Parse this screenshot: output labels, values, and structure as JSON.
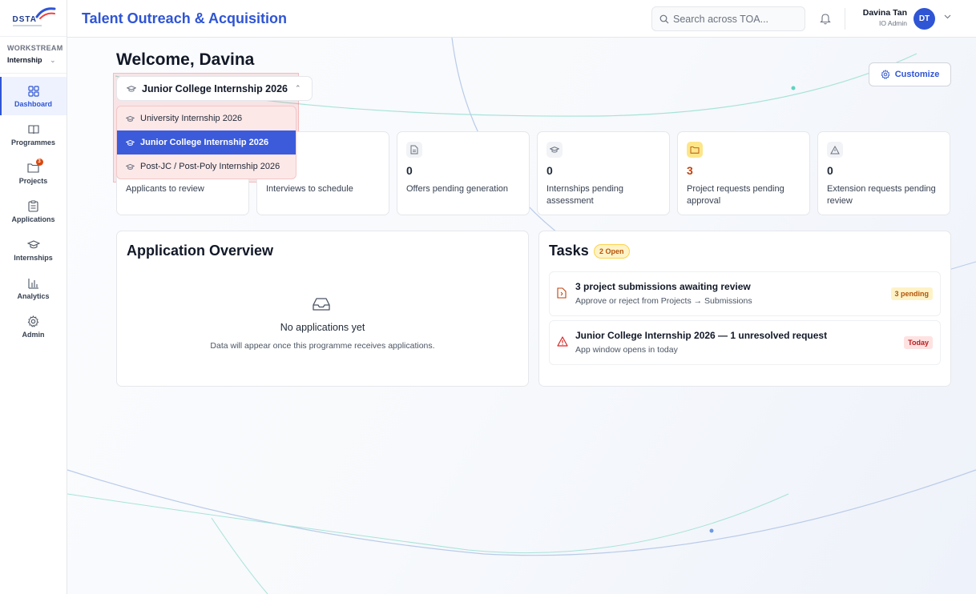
{
  "brand": {
    "logo_text": "DSTA"
  },
  "header": {
    "title": "Talent Outreach & Acquisition",
    "search_placeholder": "Search across TOA...",
    "user_name": "Davina Tan",
    "user_role": "IO Admin",
    "user_initials": "DT"
  },
  "sidebar": {
    "workstream_label": "WORKSTREAM",
    "workstream_value": "Internship",
    "items": [
      {
        "label": "Dashboard",
        "icon": "grid-icon",
        "active": true
      },
      {
        "label": "Programmes",
        "icon": "book-icon"
      },
      {
        "label": "Projects",
        "icon": "folder-icon",
        "badge": "3"
      },
      {
        "label": "Applications",
        "icon": "clipboard-icon"
      },
      {
        "label": "Internships",
        "icon": "graduation-cap-icon"
      },
      {
        "label": "Analytics",
        "icon": "bar-chart-icon"
      },
      {
        "label": "Admin",
        "icon": "gear-icon"
      }
    ]
  },
  "main": {
    "welcome": "Welcome, Davina",
    "customize_label": "Customize",
    "programme_selector": {
      "selected": "Junior College Internship 2026",
      "options": [
        "University Internship 2026",
        "Junior College Internship 2026",
        "Post-JC / Post-Poly Internship 2026"
      ]
    },
    "stats": [
      {
        "value": "",
        "label": "Applicants to review",
        "icon": "clipboard-icon"
      },
      {
        "value": "",
        "label": "Interviews to schedule",
        "icon": "calendar-icon"
      },
      {
        "value": "0",
        "label": "Offers pending generation",
        "icon": "document-icon"
      },
      {
        "value": "0",
        "label": "Internships pending assessment",
        "icon": "graduation-cap-icon"
      },
      {
        "value": "3",
        "label": "Project requests pending approval",
        "icon": "folder-icon"
      },
      {
        "value": "0",
        "label": "Extension requests pending review",
        "icon": "warning-icon"
      }
    ],
    "overview": {
      "title": "Application Overview",
      "empty_title": "No applications yet",
      "empty_sub": "Data will appear once this programme receives applications."
    },
    "tasks": {
      "title": "Tasks",
      "badge": "2 Open",
      "items": [
        {
          "title": "3 project submissions awaiting review",
          "sub": "Approve or reject from Projects → Submissions",
          "pill": "3 pending"
        },
        {
          "title": "Junior College Internship 2026 — 1 unresolved request",
          "sub": "App window opens in today",
          "pill": "Today"
        }
      ]
    }
  },
  "colors": {
    "accent": "#2f55d4",
    "warning": "#c2410c",
    "danger": "#b91c1c"
  }
}
